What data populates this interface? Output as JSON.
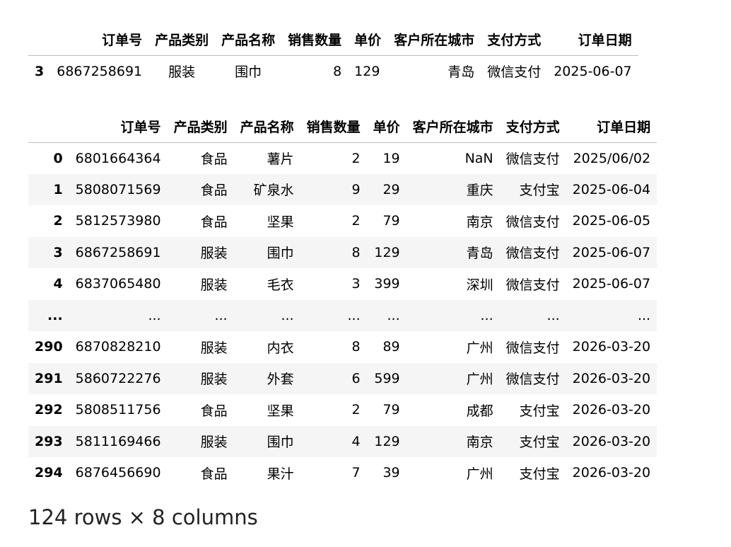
{
  "filtered_table": {
    "columns": [
      "订单号",
      "产品类别",
      "产品名称",
      "销售数量",
      "单价",
      "客户所在城市",
      "支付方式",
      "订单日期"
    ],
    "rows": [
      {
        "index": "3",
        "cells": [
          "6867258691",
          "服装",
          "围巾",
          "8",
          "129",
          "青岛",
          "微信支付",
          "2025-06-07"
        ]
      }
    ]
  },
  "preview_table": {
    "columns": [
      "订单号",
      "产品类别",
      "产品名称",
      "销售数量",
      "单价",
      "客户所在城市",
      "支付方式",
      "订单日期"
    ],
    "rows": [
      {
        "index": "0",
        "cells": [
          "6801664364",
          "食品",
          "薯片",
          "2",
          "19",
          "NaN",
          "微信支付",
          "2025/06/02"
        ]
      },
      {
        "index": "1",
        "cells": [
          "5808071569",
          "食品",
          "矿泉水",
          "9",
          "29",
          "重庆",
          "支付宝",
          "2025-06-04"
        ]
      },
      {
        "index": "2",
        "cells": [
          "5812573980",
          "食品",
          "坚果",
          "2",
          "79",
          "南京",
          "微信支付",
          "2025-06-05"
        ]
      },
      {
        "index": "3",
        "cells": [
          "6867258691",
          "服装",
          "围巾",
          "8",
          "129",
          "青岛",
          "微信支付",
          "2025-06-07"
        ]
      },
      {
        "index": "4",
        "cells": [
          "6837065480",
          "服装",
          "毛衣",
          "3",
          "399",
          "深圳",
          "微信支付",
          "2025-06-07"
        ]
      },
      {
        "index": "...",
        "cells": [
          "...",
          "...",
          "...",
          "...",
          "...",
          "...",
          "...",
          "..."
        ]
      },
      {
        "index": "290",
        "cells": [
          "6870828210",
          "服装",
          "内衣",
          "8",
          "89",
          "广州",
          "微信支付",
          "2026-03-20"
        ]
      },
      {
        "index": "291",
        "cells": [
          "5860722276",
          "服装",
          "外套",
          "6",
          "599",
          "广州",
          "微信支付",
          "2026-03-20"
        ]
      },
      {
        "index": "292",
        "cells": [
          "5808511756",
          "食品",
          "坚果",
          "2",
          "79",
          "成都",
          "支付宝",
          "2026-03-20"
        ]
      },
      {
        "index": "293",
        "cells": [
          "5811169466",
          "服装",
          "围巾",
          "4",
          "129",
          "南京",
          "支付宝",
          "2026-03-20"
        ]
      },
      {
        "index": "294",
        "cells": [
          "6876456690",
          "食品",
          "果汁",
          "7",
          "39",
          "广州",
          "支付宝",
          "2026-03-20"
        ]
      }
    ],
    "shape_caption": "124 rows × 8 columns"
  }
}
